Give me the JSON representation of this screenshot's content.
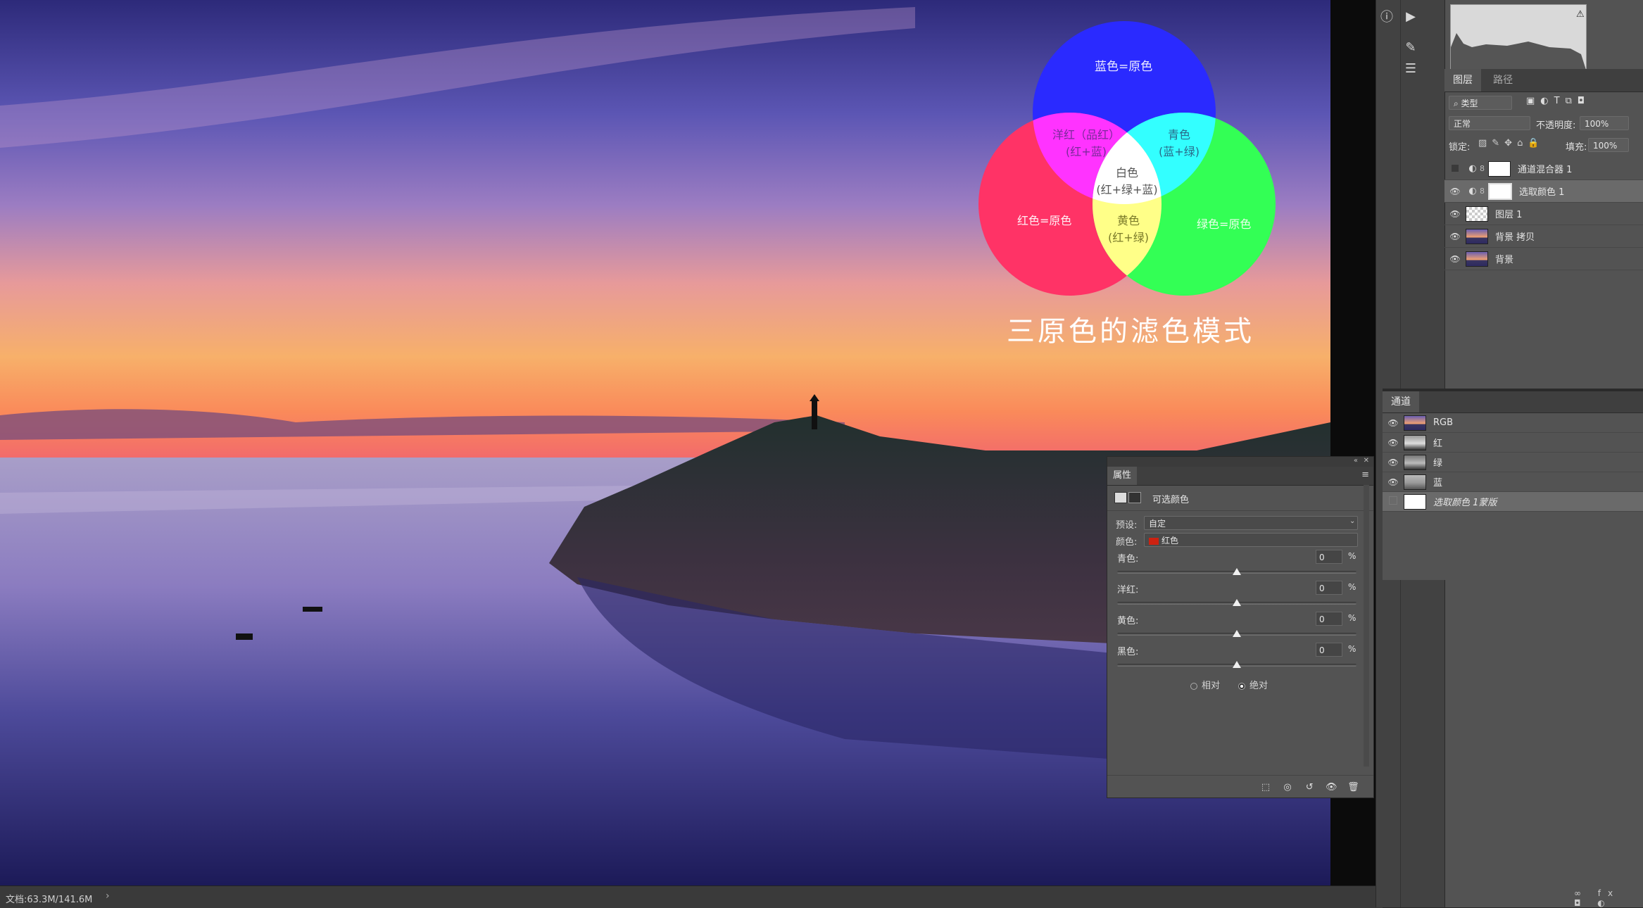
{
  "diagram": {
    "blue_label": "蓝色=原色",
    "red_label": "红色=原色",
    "green_label": "绿色=原色",
    "magenta_label": "洋红（品红）",
    "magenta_sub": "(红+蓝)",
    "cyan_label": "青色",
    "cyan_sub": "(蓝+绿)",
    "yellow_label": "黄色",
    "yellow_sub": "(红+绿)",
    "white_label": "白色",
    "white_sub": "(红+绿+蓝)",
    "caption": "三原色的滤色模式",
    "colors": {
      "red": "#ff3366",
      "green": "#33ff55",
      "blue": "#2a2aff",
      "cyan": "#33ffff",
      "magenta": "#ff33ff",
      "yellow": "#ffff88",
      "white": "#ffffff"
    }
  },
  "status": {
    "doc": "文档:63.3M/141.6M",
    "arrow": "›"
  },
  "toolbar": {
    "icons": [
      "info-icon",
      "play-icon",
      "brush-settings-icon",
      "sliders-icon"
    ]
  },
  "layers_panel": {
    "tabs": [
      {
        "label": "图层"
      },
      {
        "label": "路径"
      }
    ],
    "filter_label": "类型",
    "blend_mode": "正常",
    "opacity_label": "不透明度:",
    "opacity_value": "100%",
    "lock_label": "锁定:",
    "fill_label": "填充:",
    "fill_value": "100%",
    "layers": [
      {
        "name": "通道混合器 1",
        "visible": false,
        "kind": "adjustment",
        "selected": false
      },
      {
        "name": "选取颜色 1",
        "visible": true,
        "kind": "adjustment",
        "selected": true
      },
      {
        "name": "图层 1",
        "visible": true,
        "kind": "pixel",
        "selected": false
      },
      {
        "name": "背景 拷贝",
        "visible": true,
        "kind": "photo",
        "selected": false
      },
      {
        "name": "背景",
        "visible": true,
        "kind": "photo",
        "selected": false
      }
    ]
  },
  "channels_panel": {
    "tab": "通道",
    "channels": [
      {
        "name": "RGB"
      },
      {
        "name": "红"
      },
      {
        "name": "绿"
      },
      {
        "name": "蓝"
      },
      {
        "name": "选取颜色 1蒙版"
      }
    ]
  },
  "properties": {
    "tab": "属性",
    "title": "可选颜色",
    "preset_label": "预设:",
    "preset_value": "自定",
    "color_label": "颜色:",
    "color_value": "红色",
    "color_swatch": "#cc2211",
    "sliders": [
      {
        "label": "青色:",
        "value": "0",
        "unit": "%"
      },
      {
        "label": "洋红:",
        "value": "0",
        "unit": "%"
      },
      {
        "label": "黄色:",
        "value": "0",
        "unit": "%"
      },
      {
        "label": "黑色:",
        "value": "0",
        "unit": "%"
      }
    ],
    "relative_label": "相对",
    "absolute_label": "绝对",
    "method": "absolute"
  }
}
